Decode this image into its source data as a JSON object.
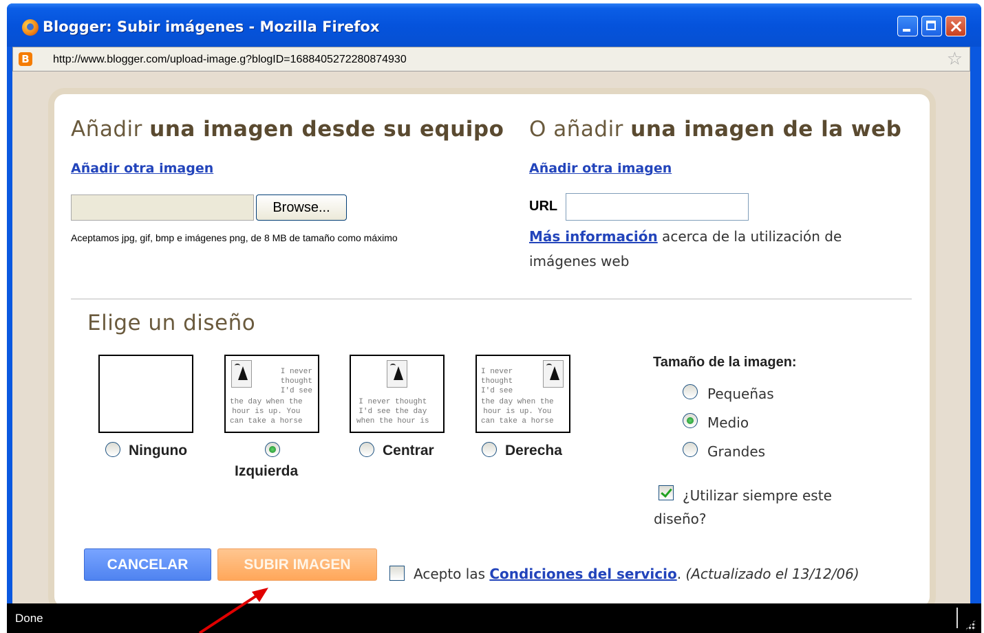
{
  "window": {
    "title": "Blogger: Subir imágenes - Mozilla Firefox",
    "url": "http://www.blogger.com/upload-image.g?blogID=1688405272280874930",
    "favicon_letter": "B"
  },
  "left_section": {
    "heading_plain": "Añadir ",
    "heading_bold": "una imagen desde su equipo",
    "add_link": "Añadir otra imagen",
    "browse_label": "Browse...",
    "note": "Aceptamos jpg, gif, bmp e imágenes png, de 8 MB de tamaño como máximo"
  },
  "right_section": {
    "heading_plain": "O añadir ",
    "heading_bold": "una imagen de la web",
    "add_link": "Añadir otra imagen",
    "url_label": "URL",
    "url_value": "",
    "more_info_link": "Más información",
    "more_info_text": " acerca de la utilización de imágenes web"
  },
  "layout": {
    "title": "Elige un diseño",
    "options": [
      {
        "label": "Ninguno",
        "selected": false
      },
      {
        "label": "Izquierda",
        "selected": true
      },
      {
        "label": "Centrar",
        "selected": false
      },
      {
        "label": "Derecha",
        "selected": false
      }
    ],
    "thumb_text": {
      "left_side": "I never\nthought\nI'd see",
      "left_bottom": "the day when the\nhour is up. You\ncan take a horse",
      "center_bottom": "I never thought\nI'd see the day\nwhen the hour is",
      "right_side": "I never\nthought\nI'd see",
      "right_bottom": "the day when the\nhour is up. You\ncan take a horse"
    }
  },
  "size": {
    "title": "Tamaño de la imagen:",
    "options": [
      {
        "label": "Pequeñas",
        "selected": false
      },
      {
        "label": "Medio",
        "selected": true
      },
      {
        "label": "Grandes",
        "selected": false
      }
    ],
    "always_label": "¿Utilizar siempre este diseño?",
    "always_checked": true
  },
  "actions": {
    "cancel": "CANCELAR",
    "upload": "SUBIR IMAGEN",
    "tos_prefix": "Acepto las ",
    "tos_link": "Condiciones del servicio",
    "tos_suffix": ". ",
    "tos_updated": "(Actualizado el 13/12/06)",
    "tos_checked": false
  },
  "status": {
    "text": "Done"
  },
  "colors": {
    "title_bar": "#0553dc",
    "link": "#2244bb",
    "cancel_button": "#5b8cf5",
    "upload_button": "#ffb676",
    "panel_border": "#e2d7c2",
    "annotation_arrow": "#e00000"
  }
}
